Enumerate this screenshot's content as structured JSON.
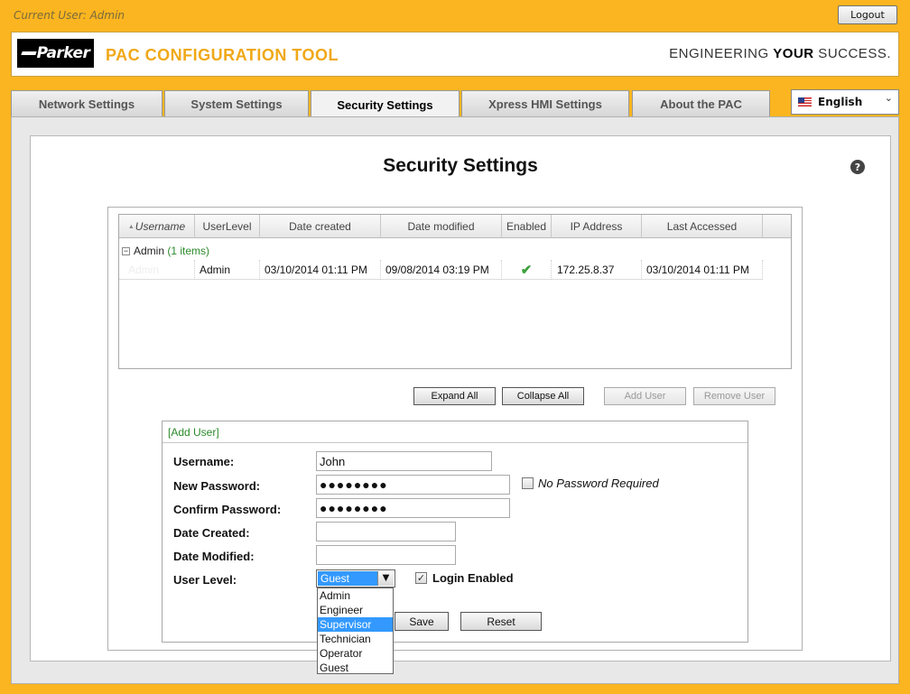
{
  "top": {
    "current_user": "Current User: Admin",
    "logout_label": "Logout"
  },
  "header": {
    "logo_text": "Parker",
    "app_title": "PAC CONFIGURATION TOOL",
    "tagline_a": "ENGINEERING ",
    "tagline_b": "YOUR",
    "tagline_c": " SUCCESS."
  },
  "tabs": [
    {
      "label": "Network Settings"
    },
    {
      "label": "System Settings"
    },
    {
      "label": "Security Settings"
    },
    {
      "label": "Xpress HMI Settings"
    },
    {
      "label": "About the PAC"
    }
  ],
  "language": {
    "selected": "English"
  },
  "page": {
    "title": "Security Settings",
    "help": "?"
  },
  "grid": {
    "headers": [
      "Username",
      "UserLevel",
      "Date created",
      "Date modified",
      "Enabled",
      "IP Address",
      "Last Accessed"
    ],
    "sort_arrow": "▲",
    "group_label": "Admin",
    "group_count": "(1 items)",
    "group_toggle": "−",
    "row": {
      "username": "Admin",
      "level": "Admin",
      "created": "03/10/2014 01:11 PM",
      "modified": "09/08/2014 03:19 PM",
      "enabled": "✔",
      "ip": "172.25.8.37",
      "last": "03/10/2014 01:11 PM"
    }
  },
  "buttons": {
    "expand": "Expand All",
    "collapse": "Collapse All",
    "add": "Add User",
    "remove": "Remove User",
    "save": "Save",
    "reset": "Reset"
  },
  "form": {
    "header": "[Add User]",
    "username_label": "Username:",
    "username_value": "John",
    "new_pw_label": "New Password:",
    "new_pw_value": "●●●●●●●●",
    "confirm_pw_label": "Confirm Password:",
    "confirm_pw_value": "●●●●●●●●",
    "no_pw_label": "No Password Required",
    "created_label": "Date Created:",
    "created_value": "",
    "modified_label": "Date Modified:",
    "modified_value": "",
    "level_label": "User Level:",
    "level_value": "Guest",
    "login_enabled_label": "Login Enabled",
    "login_enabled_check": "✓",
    "level_options": [
      "Admin",
      "Engineer",
      "Supervisor",
      "Technician",
      "Operator",
      "Guest"
    ]
  },
  "colors": {
    "background": "#fbb520",
    "accent": "#f0a818",
    "selection": "#3399ff"
  }
}
